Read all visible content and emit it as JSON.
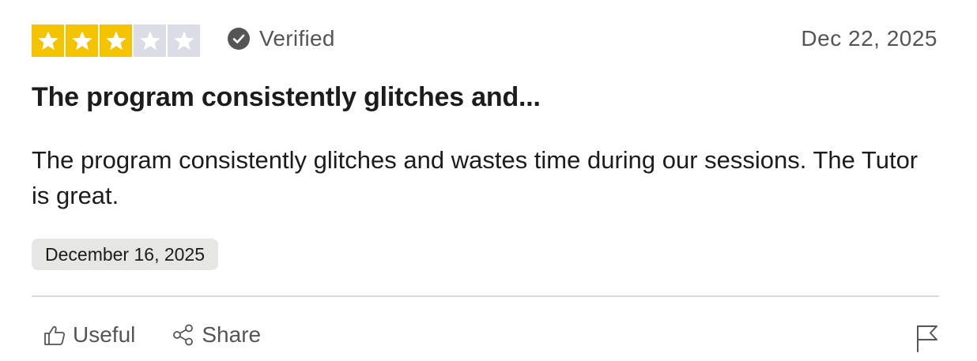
{
  "review": {
    "rating": 3,
    "max_rating": 5,
    "verified_label": "Verified",
    "date_posted": "Dec 22, 2025",
    "title": "The program consistently glitches and...",
    "body": "The program consistently glitches and wastes time during our sessions. The Tutor is great.",
    "date_of_experience": "December 16, 2025"
  },
  "actions": {
    "useful_label": "Useful",
    "share_label": "Share",
    "report_icon": "flag-icon"
  },
  "colors": {
    "star_filled": "#f5c400",
    "star_empty": "#dcdce6",
    "text_muted": "#555555",
    "badge_bg": "#e6e6e4"
  }
}
